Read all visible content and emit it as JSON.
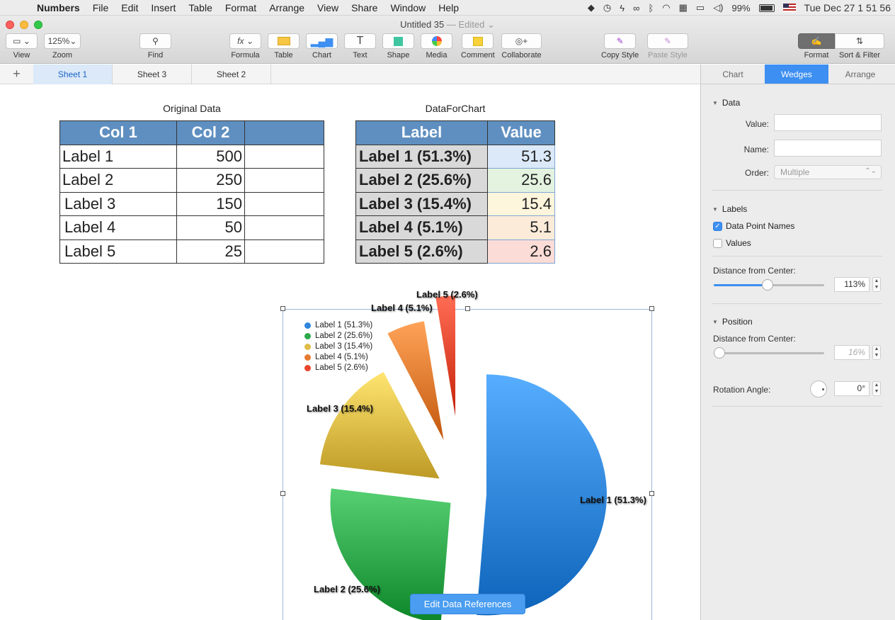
{
  "menubar": {
    "app_name": "Numbers",
    "items": [
      "File",
      "Edit",
      "Insert",
      "Table",
      "Format",
      "Arrange",
      "View",
      "Share",
      "Window",
      "Help"
    ],
    "battery": "99%",
    "clock": "Tue Dec 27  1 51 56"
  },
  "window": {
    "title": "Untitled 35",
    "status": "— Edited ⌄"
  },
  "toolbar": {
    "view_label": "View",
    "zoom_value": "125%",
    "zoom_label": "Zoom",
    "find_label": "Find",
    "formula_label": "Formula",
    "table_label": "Table",
    "chart_label": "Chart",
    "text_label": "Text",
    "shape_label": "Shape",
    "media_label": "Media",
    "comment_label": "Comment",
    "collaborate_label": "Collaborate",
    "copy_style_label": "Copy Style",
    "paste_style_label": "Paste Style",
    "format_label": "Format",
    "sort_filter_label": "Sort & Filter"
  },
  "sheets": {
    "add": "+",
    "tabs": [
      "Sheet 1",
      "Sheet 3",
      "Sheet 2"
    ],
    "active": "Sheet 1"
  },
  "inspector": {
    "tabs": [
      "Chart",
      "Wedges",
      "Arrange"
    ],
    "active_tab": "Wedges",
    "data_section": "Data",
    "value_label": "Value:",
    "name_label": "Name:",
    "order_label": "Order:",
    "order_value": "Multiple",
    "labels_section": "Labels",
    "data_point_names": "Data Point Names",
    "values_label": "Values",
    "label_distance_label": "Distance from Center:",
    "label_distance_value": "113%",
    "position_section": "Position",
    "position_distance_label": "Distance from Center:",
    "position_distance_value": "16%",
    "rotation_label": "Rotation Angle:",
    "rotation_value": "0°"
  },
  "original_table": {
    "title": "Original Data",
    "headers": [
      "Col 1",
      "Col 2",
      ""
    ],
    "rows": [
      [
        "Label 1",
        "500"
      ],
      [
        "Label 2",
        "250"
      ],
      [
        "Label 3",
        "150"
      ],
      [
        "Label 4",
        "50"
      ],
      [
        "Label 5",
        "25"
      ]
    ]
  },
  "chart_table": {
    "title": "DataForChart",
    "headers": [
      "Label",
      "Value"
    ],
    "rows": [
      [
        "Label 1 (51.3%)",
        "51.3"
      ],
      [
        "Label 2 (25.6%)",
        "25.6"
      ],
      [
        "Label 3 (15.4%)",
        "15.4"
      ],
      [
        "Label 4 (5.1%)",
        "5.1"
      ],
      [
        "Label 5 (2.6%)",
        "2.6"
      ]
    ]
  },
  "chart_data": {
    "type": "pie",
    "categories": [
      "Label 1 (51.3%)",
      "Label 2 (25.6%)",
      "Label 3 (15.4%)",
      "Label 4 (5.1%)",
      "Label 5 (2.6%)"
    ],
    "values": [
      51.3,
      25.6,
      15.4,
      5.1,
      2.6
    ],
    "colors": [
      "#2f86dc",
      "#2ea84a",
      "#e0bd48",
      "#e57b30",
      "#e8452c"
    ],
    "legend_placement": "top-left",
    "title": ""
  },
  "edit_data_references": "Edit Data References"
}
